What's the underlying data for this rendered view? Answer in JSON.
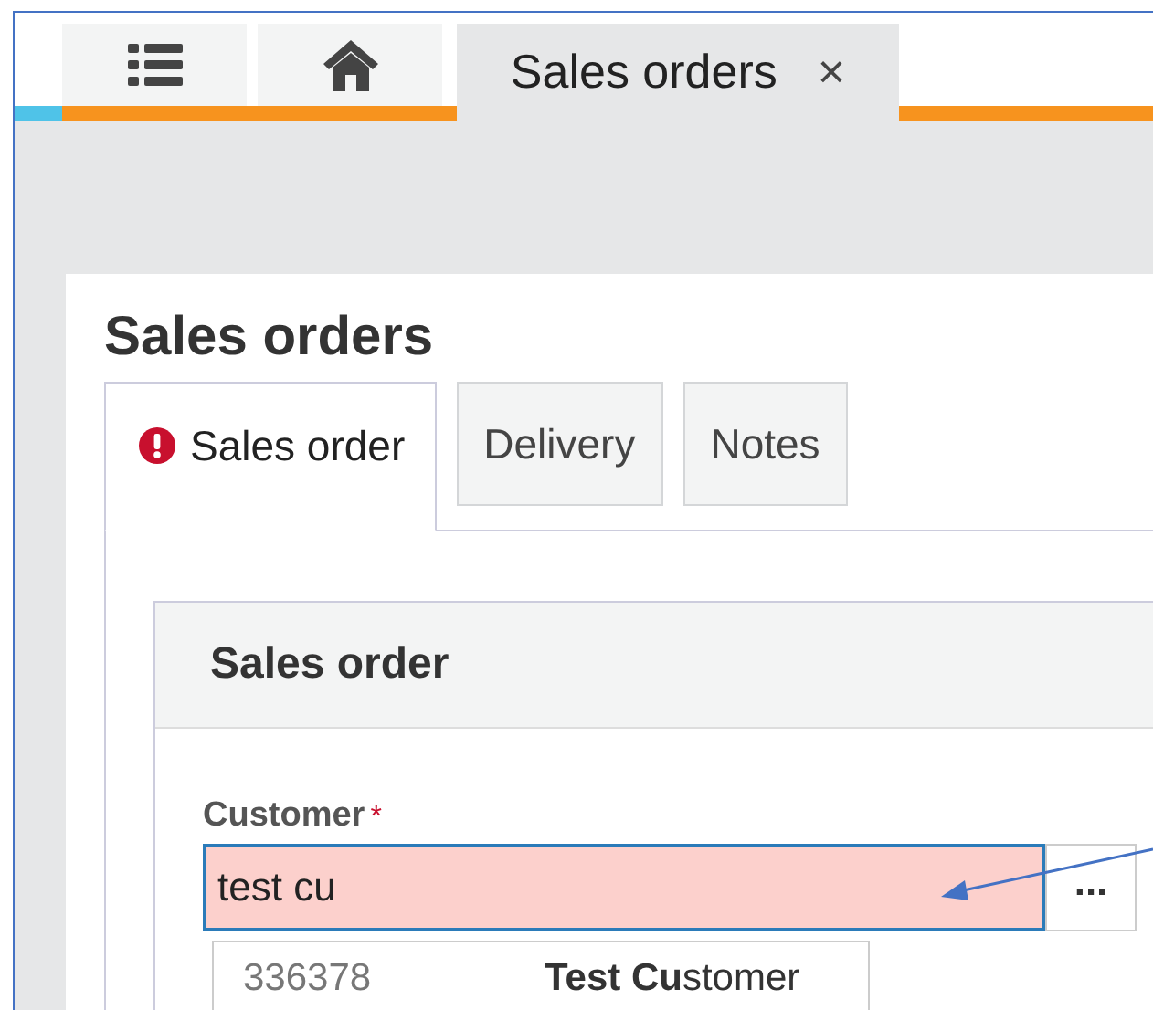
{
  "app_tabs": [
    {
      "kind": "list",
      "selected": false
    },
    {
      "kind": "home",
      "selected": false
    },
    {
      "kind": "text",
      "label": "Sales orders",
      "close": "×",
      "selected": true
    }
  ],
  "page_title": "Sales orders",
  "form_tabs": [
    {
      "label": "Sales order",
      "error": true,
      "selected": true
    },
    {
      "label": "Delivery",
      "error": false,
      "selected": false
    },
    {
      "label": "Notes",
      "error": false,
      "selected": false
    }
  ],
  "section": {
    "title": "Sales order",
    "fields": [
      {
        "label": "Customer",
        "required_mark": "*",
        "value": "test cu",
        "invalid": true,
        "lookup_button": "..."
      }
    ]
  },
  "suggestions": [
    {
      "number": "336378",
      "name": "**Test Cu**stomer"
    }
  ]
}
